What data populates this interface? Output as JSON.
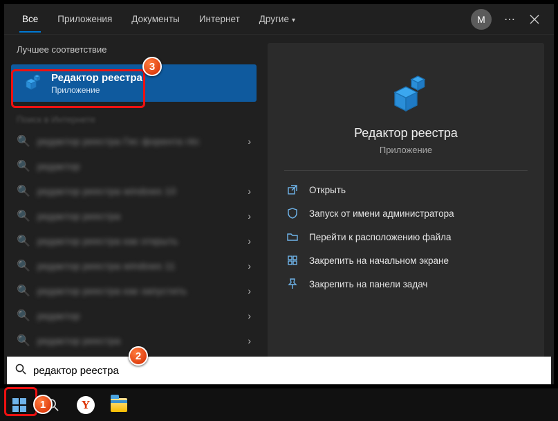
{
  "tabs": {
    "all": "Все",
    "apps": "Приложения",
    "docs": "Документы",
    "web": "Интернет",
    "more": "Другие"
  },
  "avatar_letter": "M",
  "left": {
    "section_header": "Лучшее соответствие",
    "best_match": {
      "title": "Редактор реестра",
      "subtitle": "Приложение"
    },
    "history_header": "Поиск в Интернете",
    "history": [
      "редактор реестра Гис форента гёс",
      "редактор",
      "редактор реестра windows 10",
      "редактор реестра",
      "редактор реестра как открыть",
      "редактор реестра windows 11",
      "редактор реестра как запустить",
      "редактор",
      "редактор реестра"
    ]
  },
  "right": {
    "title": "Редактор реестра",
    "subtitle": "Приложение",
    "actions": {
      "open": "Открыть",
      "run_admin": "Запуск от имени администратора",
      "open_location": "Перейти к расположению файла",
      "pin_start": "Закрепить на начальном экране",
      "pin_taskbar": "Закрепить на панели задач"
    }
  },
  "search": {
    "value": "редактор реестра"
  },
  "callouts": {
    "c1": "1",
    "c2": "2",
    "c3": "3"
  }
}
